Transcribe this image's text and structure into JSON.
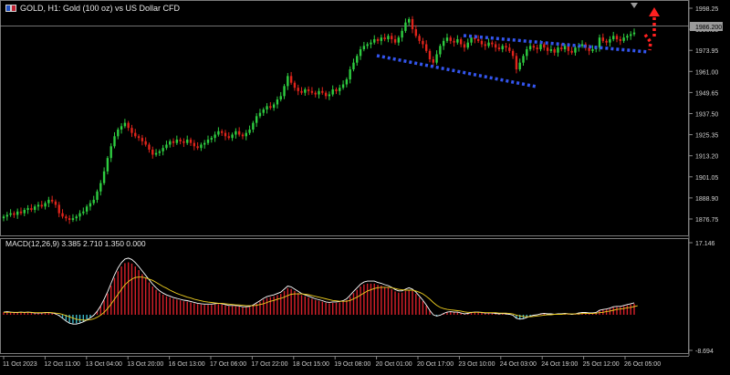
{
  "window": {
    "symbol_title": "GOLD, H1:  Gold (100 oz) vs US Dollar CFD",
    "macd_title": "MACD(12,26,9) 3.385 2.710 1.350 0.000"
  },
  "colors": {
    "background": "#000000",
    "bull": "#2ecc40",
    "bear": "#e0241b",
    "macd_main": "#ffffff",
    "macd_signal": "#f0d020",
    "hist_pos": "#d8202a",
    "hist_neg": "#3ab8c8",
    "channel": "#3355ee",
    "arrow": "#ff2020",
    "axis_text": "#d0d0d0"
  },
  "price_axis": {
    "labels": [
      "1998.25",
      "1986.00",
      "1973.95",
      "1961.00",
      "1949.65",
      "1937.50",
      "1925.35",
      "1913.20",
      "1901.05",
      "1888.90",
      "1876.75"
    ],
    "current_price_label": "1986.200"
  },
  "macd_axis": {
    "labels": [
      "17.146",
      "-8.694"
    ]
  },
  "time_axis": {
    "labels": [
      "11 Oct 2023",
      "12 Oct 11:00",
      "13 Oct 04:00",
      "13 Oct 20:00",
      "16 Oct 13:00",
      "17 Oct 06:00",
      "17 Oct 22:00",
      "18 Oct 15:00",
      "19 Oct 08:00",
      "20 Oct 01:00",
      "20 Oct 17:00",
      "23 Oct 10:00",
      "24 Oct 03:00",
      "24 Oct 19:00",
      "25 Oct 12:00",
      "26 Oct 05:00"
    ]
  },
  "chart_data": {
    "type": "candlestick",
    "symbol": "GOLD",
    "timeframe": "H1",
    "ylim": [
      1870,
      2002
    ],
    "closes": [
      1878,
      1879,
      1880,
      1879,
      1881,
      1880,
      1882,
      1883,
      1882,
      1884,
      1885,
      1884,
      1886,
      1888,
      1887,
      1885,
      1880,
      1878,
      1877,
      1876,
      1877,
      1878,
      1880,
      1881,
      1884,
      1886,
      1888,
      1893,
      1898,
      1905,
      1913,
      1920,
      1926,
      1930,
      1932,
      1934,
      1931,
      1928,
      1926,
      1925,
      1923,
      1921,
      1918,
      1915,
      1916,
      1917,
      1919,
      1921,
      1923,
      1922,
      1924,
      1923,
      1922,
      1924,
      1922,
      1920,
      1919,
      1921,
      1922,
      1924,
      1925,
      1927,
      1929,
      1928,
      1926,
      1925,
      1927,
      1929,
      1927,
      1926,
      1928,
      1930,
      1934,
      1938,
      1940,
      1942,
      1944,
      1943,
      1945,
      1948,
      1950,
      1956,
      1962,
      1958,
      1955,
      1953,
      1952,
      1954,
      1953,
      1952,
      1951,
      1953,
      1952,
      1950,
      1951,
      1954,
      1953,
      1955,
      1957,
      1960,
      1966,
      1970,
      1974,
      1978,
      1980,
      1981,
      1982,
      1984,
      1983,
      1985,
      1984,
      1986,
      1984,
      1982,
      1985,
      1989,
      1994,
      1996,
      1990,
      1986,
      1983,
      1981,
      1977,
      1972,
      1970,
      1975,
      1980,
      1983,
      1985,
      1983,
      1982,
      1984,
      1981,
      1979,
      1982,
      1985,
      1984,
      1983,
      1981,
      1980,
      1982,
      1981,
      1979,
      1978,
      1980,
      1979,
      1977,
      1974,
      1966,
      1970,
      1974,
      1978,
      1980,
      1979,
      1978,
      1981,
      1979,
      1977,
      1978,
      1976,
      1979,
      1978,
      1980,
      1977,
      1976,
      1979,
      1980,
      1981,
      1979,
      1977,
      1978,
      1979,
      1985,
      1983,
      1982,
      1984,
      1986,
      1984,
      1983,
      1985,
      1986,
      1987,
      1988
    ],
    "macd_main": [
      0.6,
      0.7,
      0.6,
      0.5,
      0.5,
      0.6,
      0.5,
      0.6,
      0.5,
      0.4,
      0.4,
      0.4,
      0.5,
      0.5,
      0.4,
      0.2,
      -0.2,
      -0.8,
      -1.4,
      -1.9,
      -2.1,
      -2.1,
      -1.9,
      -1.6,
      -1.2,
      -0.7,
      -0.1,
      0.8,
      2.0,
      3.5,
      5.2,
      7.1,
      9.0,
      10.6,
      11.8,
      12.6,
      12.8,
      12.5,
      11.8,
      10.9,
      9.9,
      8.9,
      7.9,
      6.9,
      6.1,
      5.4,
      4.9,
      4.5,
      4.2,
      3.9,
      3.7,
      3.5,
      3.3,
      3.2,
      3.0,
      2.8,
      2.6,
      2.5,
      2.4,
      2.4,
      2.4,
      2.5,
      2.6,
      2.5,
      2.3,
      2.1,
      2.1,
      2.1,
      2.0,
      1.8,
      1.8,
      1.9,
      2.2,
      2.7,
      3.2,
      3.7,
      4.1,
      4.3,
      4.5,
      4.8,
      5.1,
      5.8,
      6.5,
      6.3,
      5.8,
      5.3,
      4.8,
      4.5,
      4.2,
      3.9,
      3.6,
      3.4,
      3.2,
      2.9,
      2.8,
      2.9,
      2.9,
      3.0,
      3.2,
      3.6,
      4.4,
      5.3,
      6.1,
      6.9,
      7.4,
      7.6,
      7.6,
      7.6,
      7.3,
      7.1,
      6.8,
      6.6,
      6.2,
      5.7,
      5.4,
      5.4,
      5.8,
      6.1,
      5.8,
      5.1,
      4.2,
      3.3,
      2.2,
      1.0,
      0.0,
      -0.3,
      -0.1,
      0.3,
      0.6,
      0.7,
      0.6,
      0.6,
      0.4,
      0.2,
      0.3,
      0.5,
      0.6,
      0.6,
      0.5,
      0.4,
      0.4,
      0.4,
      0.3,
      0.2,
      0.3,
      0.2,
      0.1,
      -0.1,
      -0.8,
      -1.0,
      -0.9,
      -0.6,
      -0.3,
      -0.1,
      0.0,
      0.2,
      0.3,
      0.2,
      0.2,
      0.1,
      0.2,
      0.2,
      0.3,
      0.2,
      0.1,
      0.2,
      0.4,
      0.5,
      0.5,
      0.4,
      0.4,
      0.5,
      1.0,
      1.2,
      1.3,
      1.5,
      1.8,
      1.9,
      1.9,
      2.1,
      2.3,
      2.5,
      2.7
    ],
    "macd_signal": [
      0.6,
      0.6,
      0.6,
      0.6,
      0.6,
      0.6,
      0.6,
      0.6,
      0.6,
      0.5,
      0.5,
      0.5,
      0.5,
      0.5,
      0.5,
      0.4,
      0.3,
      0.1,
      -0.2,
      -0.5,
      -0.8,
      -1.1,
      -1.2,
      -1.3,
      -1.3,
      -1.2,
      -1.0,
      -0.6,
      -0.1,
      0.6,
      1.5,
      2.6,
      3.8,
      5.0,
      6.2,
      7.3,
      8.1,
      8.7,
      9.1,
      9.2,
      9.2,
      9.0,
      8.7,
      8.4,
      7.9,
      7.4,
      6.9,
      6.5,
      6.0,
      5.6,
      5.2,
      4.9,
      4.6,
      4.3,
      4.1,
      3.8,
      3.6,
      3.4,
      3.2,
      3.1,
      3.0,
      2.9,
      2.8,
      2.8,
      2.7,
      2.6,
      2.5,
      2.4,
      2.4,
      2.3,
      2.2,
      2.2,
      2.2,
      2.3,
      2.5,
      2.7,
      3.0,
      3.3,
      3.5,
      3.8,
      4.0,
      4.3,
      4.7,
      5.0,
      5.1,
      5.1,
      5.1,
      5.0,
      4.9,
      4.7,
      4.5,
      4.3,
      4.1,
      3.9,
      3.7,
      3.5,
      3.4,
      3.3,
      3.3,
      3.3,
      3.5,
      3.9,
      4.3,
      4.8,
      5.3,
      5.8,
      6.1,
      6.4,
      6.6,
      6.7,
      6.7,
      6.7,
      6.6,
      6.4,
      6.2,
      6.1,
      6.0,
      6.0,
      6.0,
      5.8,
      5.5,
      5.1,
      4.5,
      3.8,
      3.0,
      2.3,
      1.8,
      1.5,
      1.3,
      1.2,
      1.1,
      1.0,
      0.9,
      0.7,
      0.6,
      0.6,
      0.6,
      0.6,
      0.6,
      0.5,
      0.5,
      0.5,
      0.5,
      0.4,
      0.4,
      0.4,
      0.3,
      0.2,
      -0.1,
      -0.3,
      -0.4,
      -0.5,
      -0.5,
      -0.4,
      -0.3,
      -0.2,
      -0.1,
      0.0,
      0.0,
      0.1,
      0.1,
      0.1,
      0.2,
      0.2,
      0.2,
      0.2,
      0.2,
      0.3,
      0.3,
      0.3,
      0.3,
      0.4,
      0.5,
      0.6,
      0.8,
      0.9,
      1.1,
      1.3,
      1.4,
      1.5,
      1.7,
      1.8,
      2.0,
      2.2
    ]
  },
  "annotations": {
    "channel_color": "#3355ee",
    "arrow_color": "#ff2020"
  }
}
